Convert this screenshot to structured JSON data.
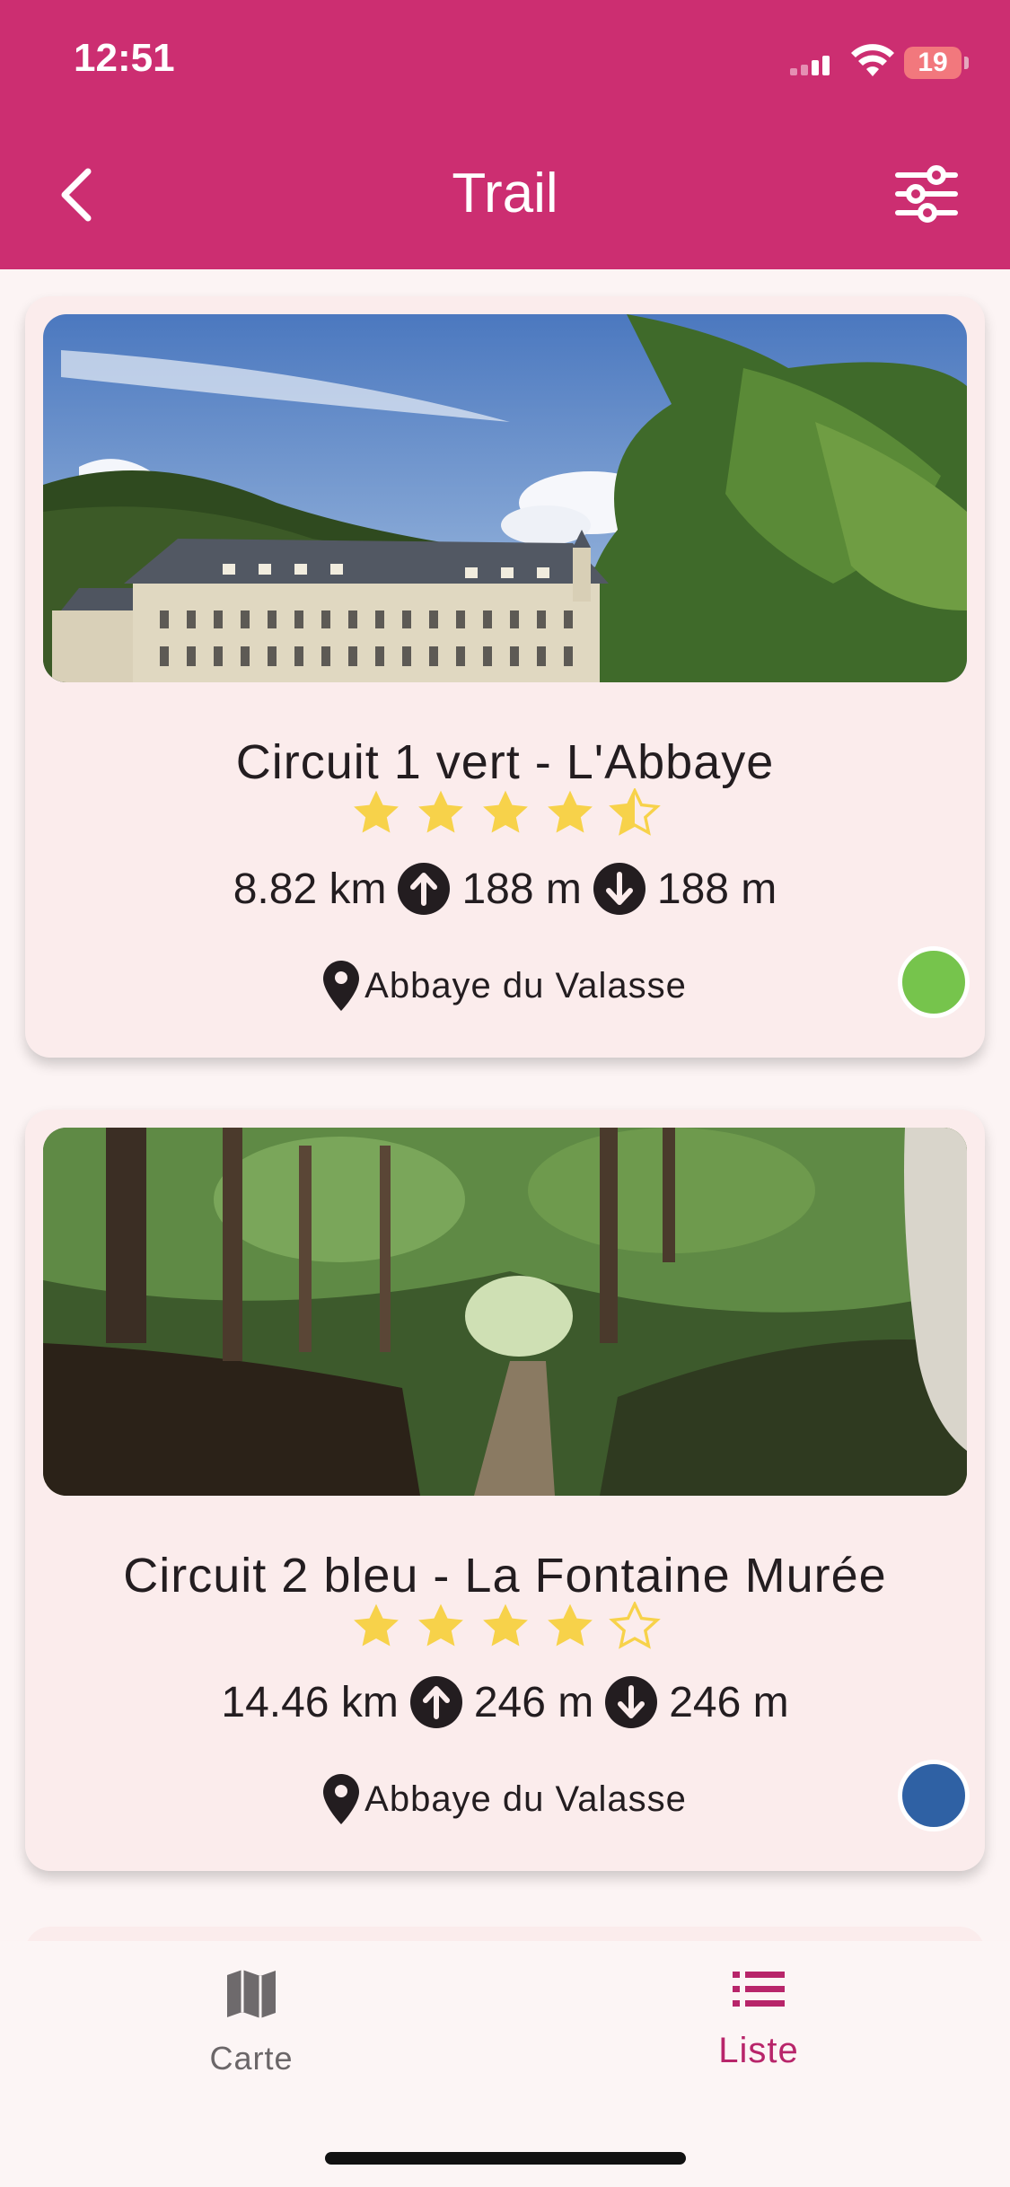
{
  "status_bar": {
    "time": "12:51",
    "battery_level": "19"
  },
  "header": {
    "title": "Trail"
  },
  "colors": {
    "brand": "#cc2e71",
    "star": "#f7d24a",
    "green_dot": "#76c44c",
    "blue_dot": "#2f61a4"
  },
  "trails": [
    {
      "name": "Circuit 1 vert - L'Abbaye",
      "rating": 4.5,
      "distance": "8.82 km",
      "ascent": "188 m",
      "descent": "188 m",
      "location": "Abbaye du Valasse",
      "color": "#76c44c",
      "image": "abbey-photo"
    },
    {
      "name": "Circuit 2 bleu - La Fontaine Murée",
      "rating": 4,
      "distance": "14.46 km",
      "ascent": "246 m",
      "descent": "246 m",
      "location": "Abbaye du Valasse",
      "color": "#2f61a4",
      "image": "forest-path-photo"
    }
  ],
  "bottom_nav": {
    "items": [
      {
        "label": "Carte",
        "icon": "map-icon",
        "active": false
      },
      {
        "label": "Liste",
        "icon": "list-icon",
        "active": true
      }
    ]
  }
}
